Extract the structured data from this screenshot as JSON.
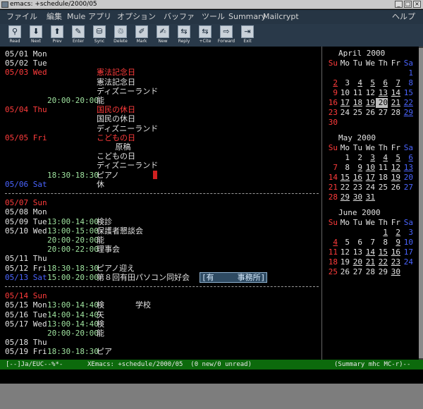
{
  "window": {
    "title": "emacs: +schedule/2000/05",
    "min": "_",
    "max": "□",
    "close": "×"
  },
  "menu": {
    "items": [
      "ファイル",
      "編集",
      "Mule",
      "アプリ",
      "オプション",
      "バッファ",
      "ツール",
      "Summary",
      "Mailcrypt"
    ],
    "help": "ヘルプ"
  },
  "toolbar": [
    {
      "label": "Read",
      "icon": "read-icon",
      "glyph": "⚲"
    },
    {
      "label": "Next",
      "icon": "arrow-down-icon",
      "glyph": "⬇"
    },
    {
      "label": "Prev",
      "icon": "arrow-up-icon",
      "glyph": "⬆"
    },
    {
      "label": "Enter",
      "icon": "enter-icon",
      "glyph": "✎"
    },
    {
      "label": "Sync",
      "icon": "sync-icon",
      "glyph": "⛁"
    },
    {
      "label": "Delete",
      "icon": "delete-icon",
      "glyph": "♲"
    },
    {
      "label": "Mark",
      "icon": "mark-icon",
      "glyph": "✐"
    },
    {
      "label": "New",
      "icon": "new-icon",
      "glyph": "✍"
    },
    {
      "label": "Reply",
      "icon": "reply-icon",
      "glyph": "⇆"
    },
    {
      "label": "+Cite",
      "icon": "cite-icon",
      "glyph": "⇆"
    },
    {
      "label": "Forward",
      "icon": "forward-icon",
      "glyph": "⇨"
    },
    {
      "label": "Exit",
      "icon": "exit-icon",
      "glyph": "⇥"
    }
  ],
  "schedule": [
    {
      "date": "05/01 Mon",
      "time": "",
      "text": "",
      "dc": "wht",
      "xc": "wht"
    },
    {
      "date": "05/02 Tue",
      "time": "",
      "text": "",
      "dc": "wht",
      "xc": "wht"
    },
    {
      "date": "05/03 Wed",
      "time": "",
      "text": "憲法記念日",
      "dc": "red",
      "xc": "red"
    },
    {
      "date": "",
      "time": "",
      "text": "憲法記念日",
      "dc": "wht",
      "xc": "wht"
    },
    {
      "date": "",
      "time": "",
      "text": "ディズニーランド",
      "dc": "wht",
      "xc": "wht"
    },
    {
      "date": "",
      "time": "20:00-20:00",
      "text": "能",
      "dc": "wht",
      "xc": "wht"
    },
    {
      "date": "05/04 Thu",
      "time": "",
      "text": "国民の休日",
      "dc": "red",
      "xc": "red"
    },
    {
      "date": "",
      "time": "",
      "text": "国民の休日",
      "dc": "wht",
      "xc": "wht"
    },
    {
      "date": "",
      "time": "",
      "text": "ディズニーランド",
      "dc": "wht",
      "xc": "wht"
    },
    {
      "date": "05/05 Fri",
      "time": "",
      "text": "こどもの日",
      "dc": "red",
      "xc": "red"
    },
    {
      "date": "",
      "time": "",
      "text": "    原稿",
      "dc": "wht",
      "xc": "wht"
    },
    {
      "date": "",
      "time": "",
      "text": "こどもの日",
      "dc": "wht",
      "xc": "wht"
    },
    {
      "date": "",
      "time": "",
      "text": "ディズニーランド",
      "dc": "wht",
      "xc": "wht"
    },
    {
      "date": "",
      "time": "18:30-18:30",
      "text": "ピアノ",
      "dc": "wht",
      "xc": "wht",
      "cursor": true
    },
    {
      "date": "05/06 Sat",
      "time": "",
      "text": "休",
      "dc": "blue",
      "xc": "wht"
    },
    {
      "rule": true
    },
    {
      "date": "05/07 Sun",
      "time": "",
      "text": "",
      "dc": "red",
      "xc": "wht"
    },
    {
      "date": "05/08 Mon",
      "time": "",
      "text": "",
      "dc": "wht",
      "xc": "wht"
    },
    {
      "date": "05/09 Tue",
      "time": "13:00-14:00",
      "text": "検診",
      "dc": "wht",
      "xc": "wht"
    },
    {
      "date": "05/10 Wed",
      "time": "13:00-15:00",
      "text": "保護者懇談会",
      "dc": "wht",
      "xc": "wht"
    },
    {
      "date": "",
      "time": "20:00-20:00",
      "text": "能",
      "dc": "wht",
      "xc": "wht"
    },
    {
      "date": "",
      "time": "20:00-22:00",
      "text": "理事会",
      "dc": "wht",
      "xc": "wht"
    },
    {
      "date": "05/11 Thu",
      "time": "",
      "text": "",
      "dc": "wht",
      "xc": "wht"
    },
    {
      "date": "05/12 Fri",
      "time": "18:30-18:30",
      "text": "ピアノ迎え",
      "dc": "wht",
      "xc": "wht"
    },
    {
      "date": "05/13 Sat",
      "time": "15:00-20:00",
      "text": "第８回有田パソコン同好会",
      "dc": "blue",
      "xc": "wht",
      "tag": "[有　　　事務所]"
    },
    {
      "rule": true
    },
    {
      "date": "05/14 Sun",
      "time": "",
      "text": "",
      "dc": "red",
      "xc": "wht"
    },
    {
      "date": "05/15 Mon",
      "time": "13:00-14:40",
      "text": "検　　　　学校",
      "dc": "wht",
      "xc": "wht"
    },
    {
      "date": "05/16 Tue",
      "time": "14:00-14:40",
      "text": "矢",
      "dc": "wht",
      "xc": "wht"
    },
    {
      "date": "05/17 Wed",
      "time": "13:00-14:40",
      "text": "検",
      "dc": "wht",
      "xc": "wht"
    },
    {
      "date": "",
      "time": "20:00-20:00",
      "text": "能",
      "dc": "wht",
      "xc": "wht"
    },
    {
      "date": "05/18 Thu",
      "time": "",
      "text": "",
      "dc": "wht",
      "xc": "wht"
    },
    {
      "date": "05/19 Fri",
      "time": "18:30-18:30",
      "text": "ピア",
      "dc": "wht",
      "xc": "wht"
    }
  ],
  "calendars": [
    {
      "title": "April 2000",
      "days": [
        "Su",
        "Mo",
        "Tu",
        "We",
        "Th",
        "Fr",
        "Sa"
      ],
      "first": 6,
      "ndays": 30,
      "underlined": [
        2,
        4,
        5,
        6,
        7,
        13,
        14,
        17,
        18,
        19,
        21,
        22,
        29
      ],
      "today": 20
    },
    {
      "title": "May 2000",
      "days": [
        "Su",
        "Mo",
        "Tu",
        "We",
        "Th",
        "Fr",
        "Sa"
      ],
      "first": 1,
      "ndays": 31,
      "underlined": [
        3,
        4,
        5,
        6,
        9,
        10,
        12,
        13,
        15,
        16,
        17,
        19,
        29,
        30,
        31
      ],
      "today": 0
    },
    {
      "title": "June 2000",
      "days": [
        "Su",
        "Mo",
        "Tu",
        "We",
        "Th",
        "Fr",
        "Sa"
      ],
      "first": 4,
      "ndays": 30,
      "underlined": [
        1,
        2,
        4,
        9,
        14,
        15,
        16,
        20,
        21,
        22,
        23,
        30
      ],
      "today": 0
    }
  ],
  "modeline": {
    "left": "[--]Ja/EUC--%*-",
    "mid": "XEmacs: +schedule/2000/05  (0 new/0 unread)",
    "right": "(Summary mhc MC-r)--"
  }
}
